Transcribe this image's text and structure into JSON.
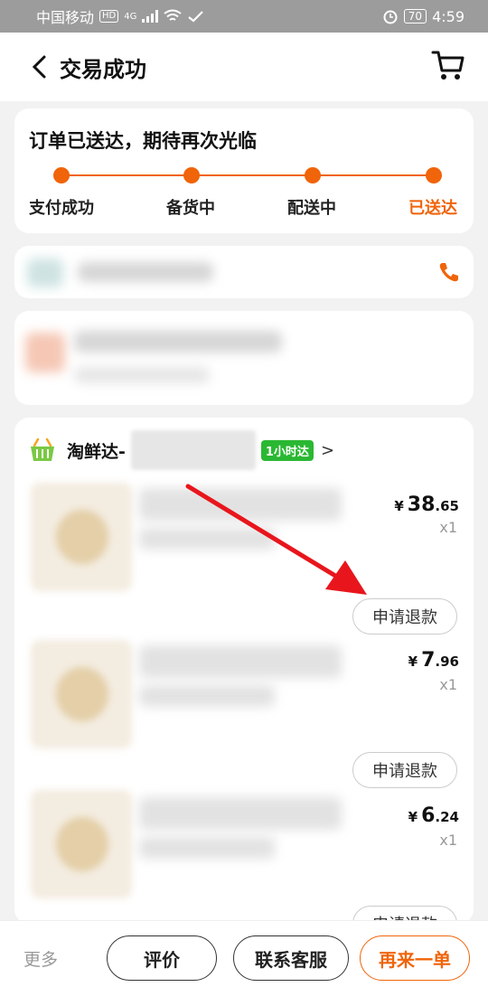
{
  "status_bar": {
    "carrier": "中国移动",
    "hd": "HD",
    "net": "4G",
    "battery": "70",
    "time": "4:59"
  },
  "header": {
    "title": "交易成功"
  },
  "progress": {
    "title": "订单已送达，期待再次光临",
    "steps": [
      "支付成功",
      "备货中",
      "配送中",
      "已送达"
    ],
    "active_index": 3
  },
  "store": {
    "name": "淘鲜达-",
    "badge": "1小时达",
    "chevron": ">"
  },
  "items": [
    {
      "price_symbol": "¥",
      "price_int": "38",
      "price_dec": ".65",
      "qty": "x1",
      "refund_label": "申请退款"
    },
    {
      "price_symbol": "¥",
      "price_int": "7",
      "price_dec": ".96",
      "qty": "x1",
      "refund_label": "申请退款"
    },
    {
      "price_symbol": "¥",
      "price_int": "6",
      "price_dec": ".24",
      "qty": "x1",
      "refund_label": "申请退款"
    }
  ],
  "bottom_bar": {
    "more": "更多",
    "review": "评价",
    "contact": "联系客服",
    "reorder": "再来一单"
  },
  "colors": {
    "accent": "#f0640a",
    "badge_green": "#2ab833",
    "annotation_arrow": "#e8161c"
  }
}
